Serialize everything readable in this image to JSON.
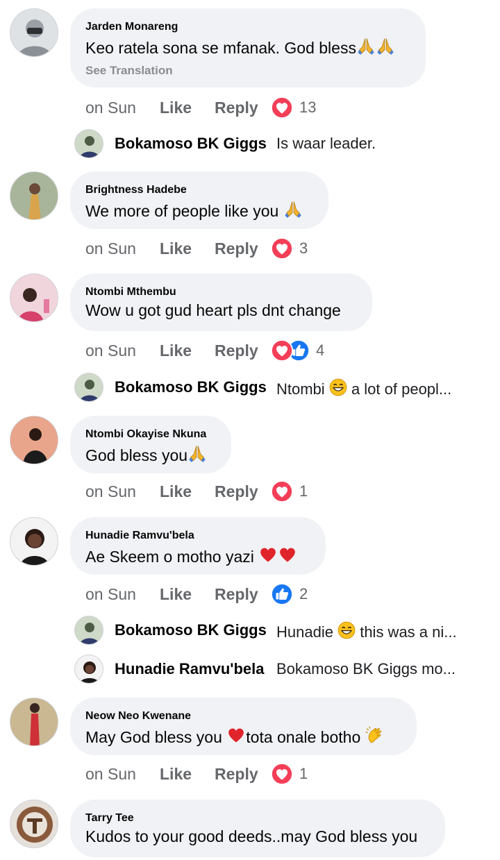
{
  "comments": [
    {
      "name": "Jarden Monareng",
      "text": "Keo ratela sona se mfanak. God bless",
      "see_translation": "See Translation",
      "time": "on Sun",
      "like": "Like",
      "reply": "Reply",
      "reaction_count": "13"
    },
    {
      "name": "Brightness Hadebe",
      "text": "We more of people like you",
      "time": "on Sun",
      "like": "Like",
      "reply": "Reply",
      "reaction_count": "3"
    },
    {
      "name": "Ntombi Mthembu",
      "text": "Wow u got gud heart pls dnt change",
      "time": "on Sun",
      "like": "Like",
      "reply": "Reply",
      "reaction_count": "4"
    },
    {
      "name": "Ntombi Okayise Nkuna",
      "text": "God bless you",
      "time": "on Sun",
      "like": "Like",
      "reply": "Reply",
      "reaction_count": "1"
    },
    {
      "name": "Hunadie Ramvu'bela",
      "text": "Ae Skeem o motho yazi",
      "time": "on Sun",
      "like": "Like",
      "reply": "Reply",
      "reaction_count": "2"
    },
    {
      "name": "Neow Neo Kwenane",
      "text_a": "May God bless you",
      "text_b": "tota onale botho",
      "time": "on Sun",
      "like": "Like",
      "reply": "Reply",
      "reaction_count": "1"
    },
    {
      "name": "Tarry Tee",
      "text": "Kudos to your good deeds..may God bless you"
    }
  ],
  "replies": [
    {
      "name": "Bokamoso BK Giggs",
      "text": "Is waar leader."
    },
    {
      "name": "Bokamoso BK Giggs",
      "text_a": "Ntombi",
      "text_b": "a lot of peopl..."
    },
    {
      "name": "Bokamoso BK Giggs",
      "text_a": "Hunadie",
      "text_b": "this was a ni..."
    },
    {
      "name": "Hunadie Ramvu'bela",
      "text": "Bokamoso BK Giggs mo..."
    }
  ],
  "colors": {
    "bubble": "#f0f2f5",
    "love": "#f33e58",
    "like": "#1877f2",
    "meta": "#65676b"
  }
}
